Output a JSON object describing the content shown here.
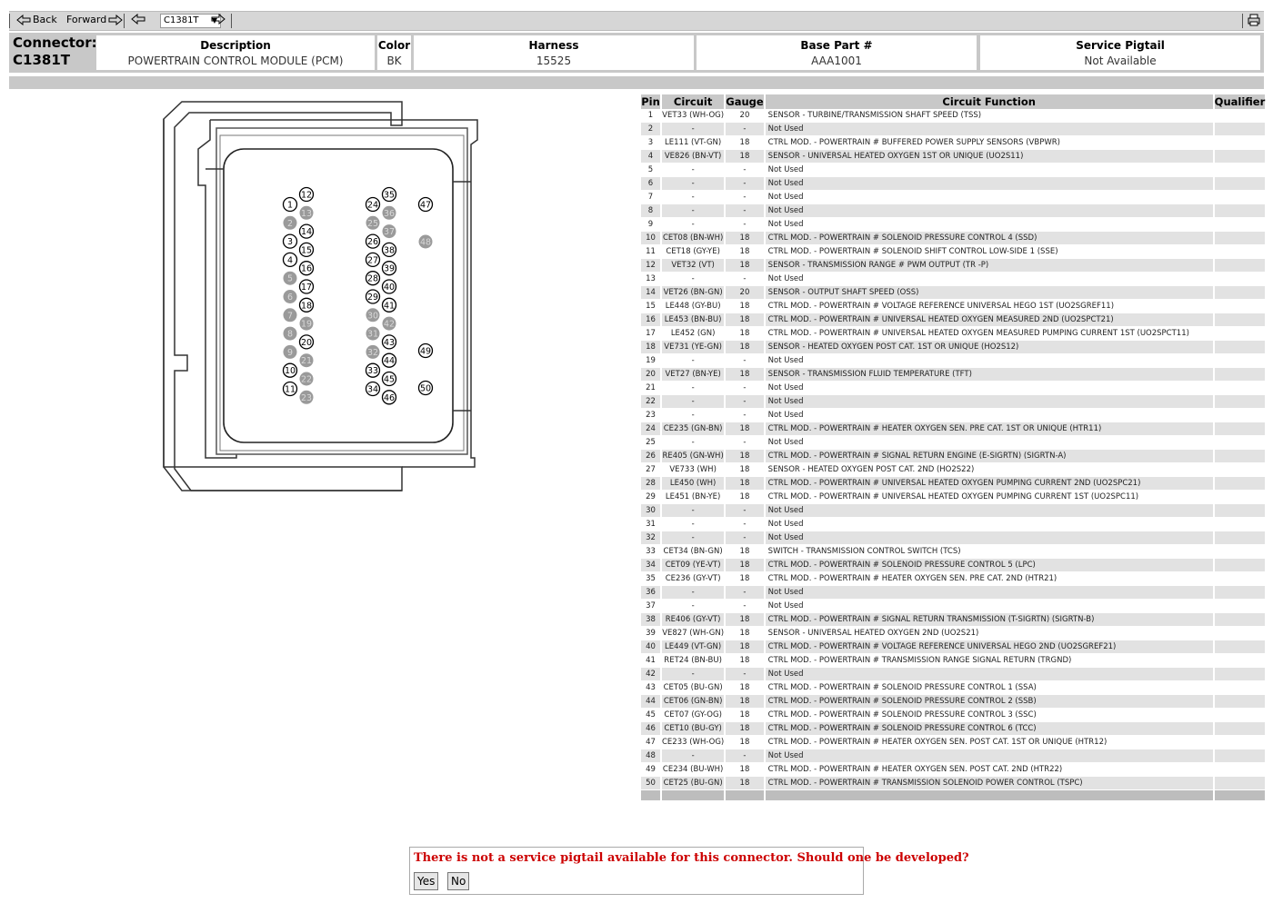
{
  "toolbar": {
    "back_label": "Back",
    "forward_label": "Forward",
    "connector_select": "C1381T"
  },
  "header": {
    "connector_label": "Connector:",
    "connector_id": "C1381T",
    "description_label": "Description",
    "description_value": "POWERTRAIN CONTROL MODULE (PCM)",
    "color_label": "Color",
    "color_value": "BK",
    "harness_label": "Harness",
    "harness_value": "15525",
    "base_part_label": "Base Part #",
    "base_part_value": "AAA1001",
    "pigtail_label": "Service Pigtail",
    "pigtail_value": "Not Available"
  },
  "table": {
    "headers": [
      "Pin",
      "Circuit",
      "Gauge",
      "Circuit Function",
      "Qualifier"
    ],
    "rows": [
      [
        "1",
        "VET33 (WH-OG)",
        "20",
        "SENSOR - TURBINE/TRANSMISSION SHAFT SPEED (TSS)",
        ""
      ],
      [
        "2",
        "-",
        "-",
        "Not Used",
        ""
      ],
      [
        "3",
        "LE111 (VT-GN)",
        "18",
        "CTRL MOD. - POWERTRAIN # BUFFERED POWER SUPPLY SENSORS (VBPWR)",
        ""
      ],
      [
        "4",
        "VE826 (BN-VT)",
        "18",
        "SENSOR - UNIVERSAL HEATED OXYGEN 1ST OR UNIQUE (UO2S11)",
        ""
      ],
      [
        "5",
        "-",
        "-",
        "Not Used",
        ""
      ],
      [
        "6",
        "-",
        "-",
        "Not Used",
        ""
      ],
      [
        "7",
        "-",
        "-",
        "Not Used",
        ""
      ],
      [
        "8",
        "-",
        "-",
        "Not Used",
        ""
      ],
      [
        "9",
        "-",
        "-",
        "Not Used",
        ""
      ],
      [
        "10",
        "CET08 (BN-WH)",
        "18",
        "CTRL MOD. - POWERTRAIN # SOLENOID PRESSURE CONTROL 4 (SSD)",
        ""
      ],
      [
        "11",
        "CET18 (GY-YE)",
        "18",
        "CTRL MOD. - POWERTRAIN # SOLENOID SHIFT CONTROL LOW-SIDE 1 (SSE)",
        ""
      ],
      [
        "12",
        "VET32 (VT)",
        "18",
        "SENSOR - TRANSMISSION RANGE # PWM OUTPUT (TR -P)",
        ""
      ],
      [
        "13",
        "-",
        "-",
        "Not Used",
        ""
      ],
      [
        "14",
        "VET26 (BN-GN)",
        "20",
        "SENSOR - OUTPUT SHAFT SPEED (OSS)",
        ""
      ],
      [
        "15",
        "LE448 (GY-BU)",
        "18",
        "CTRL MOD. - POWERTRAIN # VOLTAGE REFERENCE UNIVERSAL HEGO 1ST (UO2SGREF11)",
        ""
      ],
      [
        "16",
        "LE453 (BN-BU)",
        "18",
        "CTRL MOD. - POWERTRAIN # UNIVERSAL HEATED OXYGEN MEASURED 2ND (UO2SPCT21)",
        ""
      ],
      [
        "17",
        "LE452 (GN)",
        "18",
        "CTRL MOD. - POWERTRAIN # UNIVERSAL HEATED OXYGEN MEASURED PUMPING CURRENT 1ST (UO2SPCT11)",
        ""
      ],
      [
        "18",
        "VE731 (YE-GN)",
        "18",
        "SENSOR - HEATED OXYGEN POST CAT. 1ST OR UNIQUE (HO2S12)",
        ""
      ],
      [
        "19",
        "-",
        "-",
        "Not Used",
        ""
      ],
      [
        "20",
        "VET27 (BN-YE)",
        "18",
        "SENSOR - TRANSMISSION FLUID TEMPERATURE (TFT)",
        ""
      ],
      [
        "21",
        "-",
        "-",
        "Not Used",
        ""
      ],
      [
        "22",
        "-",
        "-",
        "Not Used",
        ""
      ],
      [
        "23",
        "-",
        "-",
        "Not Used",
        ""
      ],
      [
        "24",
        "CE235 (GN-BN)",
        "18",
        "CTRL MOD. - POWERTRAIN # HEATER OXYGEN SEN. PRE CAT. 1ST OR UNIQUE (HTR11)",
        ""
      ],
      [
        "25",
        "-",
        "-",
        "Not Used",
        ""
      ],
      [
        "26",
        "RE405 (GN-WH)",
        "18",
        "CTRL MOD. - POWERTRAIN # SIGNAL RETURN ENGINE (E-SIGRTN) (SIGRTN-A)",
        ""
      ],
      [
        "27",
        "VE733 (WH)",
        "18",
        "SENSOR - HEATED OXYGEN POST CAT. 2ND (HO2S22)",
        ""
      ],
      [
        "28",
        "LE450 (WH)",
        "18",
        "CTRL MOD. - POWERTRAIN # UNIVERSAL HEATED OXYGEN PUMPING CURRENT 2ND (UO2SPC21)",
        ""
      ],
      [
        "29",
        "LE451 (BN-YE)",
        "18",
        "CTRL MOD. - POWERTRAIN # UNIVERSAL HEATED OXYGEN PUMPING CURRENT 1ST (UO2SPC11)",
        ""
      ],
      [
        "30",
        "-",
        "-",
        "Not Used",
        ""
      ],
      [
        "31",
        "-",
        "-",
        "Not Used",
        ""
      ],
      [
        "32",
        "-",
        "-",
        "Not Used",
        ""
      ],
      [
        "33",
        "CET34 (BN-GN)",
        "18",
        "SWITCH - TRANSMISSION CONTROL SWITCH (TCS)",
        ""
      ],
      [
        "34",
        "CET09 (YE-VT)",
        "18",
        "CTRL MOD. - POWERTRAIN # SOLENOID PRESSURE CONTROL 5 (LPC)",
        ""
      ],
      [
        "35",
        "CE236 (GY-VT)",
        "18",
        "CTRL MOD. - POWERTRAIN # HEATER OXYGEN SEN. PRE CAT. 2ND (HTR21)",
        ""
      ],
      [
        "36",
        "-",
        "-",
        "Not Used",
        ""
      ],
      [
        "37",
        "-",
        "-",
        "Not Used",
        ""
      ],
      [
        "38",
        "RE406 (GY-VT)",
        "18",
        "CTRL MOD. - POWERTRAIN # SIGNAL RETURN TRANSMISSION (T-SIGRTN) (SIGRTN-B)",
        ""
      ],
      [
        "39",
        "VE827 (WH-GN)",
        "18",
        "SENSOR - UNIVERSAL HEATED OXYGEN 2ND (UO2S21)",
        ""
      ],
      [
        "40",
        "LE449 (VT-GN)",
        "18",
        "CTRL MOD. - POWERTRAIN # VOLTAGE REFERENCE UNIVERSAL HEGO 2ND (UO2SGREF21)",
        ""
      ],
      [
        "41",
        "RET24 (BN-BU)",
        "18",
        "CTRL MOD. - POWERTRAIN # TRANSMISSION RANGE SIGNAL RETURN (TRGND)",
        ""
      ],
      [
        "42",
        "-",
        "-",
        "Not Used",
        ""
      ],
      [
        "43",
        "CET05 (BU-GN)",
        "18",
        "CTRL MOD. - POWERTRAIN # SOLENOID PRESSURE CONTROL 1 (SSA)",
        ""
      ],
      [
        "44",
        "CET06 (GN-BN)",
        "18",
        "CTRL MOD. - POWERTRAIN # SOLENOID PRESSURE CONTROL 2 (SSB)",
        ""
      ],
      [
        "45",
        "CET07 (GY-OG)",
        "18",
        "CTRL MOD. - POWERTRAIN # SOLENOID PRESSURE CONTROL 3 (SSC)",
        ""
      ],
      [
        "46",
        "CET10 (BU-GY)",
        "18",
        "CTRL MOD. - POWERTRAIN # SOLENOID PRESSURE CONTROL 6 (TCC)",
        ""
      ],
      [
        "47",
        "CE233 (WH-OG)",
        "18",
        "CTRL MOD. - POWERTRAIN # HEATER OXYGEN SEN. POST CAT. 1ST OR UNIQUE (HTR12)",
        ""
      ],
      [
        "48",
        "-",
        "-",
        "Not Used",
        ""
      ],
      [
        "49",
        "CE234 (BU-WH)",
        "18",
        "CTRL MOD. - POWERTRAIN # HEATER OXYGEN SEN. POST CAT. 2ND (HTR22)",
        ""
      ],
      [
        "50",
        "CET25 (BU-GN)",
        "18",
        "CTRL MOD. - POWERTRAIN # TRANSMISSION SOLENOID POWER CONTROL (TSPC)",
        ""
      ]
    ]
  },
  "diagram": {
    "pins": [
      {
        "n": "1",
        "used": true
      },
      {
        "n": "2",
        "used": false
      },
      {
        "n": "3",
        "used": true
      },
      {
        "n": "4",
        "used": true
      },
      {
        "n": "5",
        "used": false
      },
      {
        "n": "6",
        "used": false
      },
      {
        "n": "7",
        "used": false
      },
      {
        "n": "8",
        "used": false
      },
      {
        "n": "9",
        "used": false
      },
      {
        "n": "10",
        "used": true
      },
      {
        "n": "11",
        "used": true
      },
      {
        "n": "12",
        "used": true
      },
      {
        "n": "13",
        "used": false
      },
      {
        "n": "14",
        "used": true
      },
      {
        "n": "15",
        "used": true
      },
      {
        "n": "16",
        "used": true
      },
      {
        "n": "17",
        "used": true
      },
      {
        "n": "18",
        "used": true
      },
      {
        "n": "19",
        "used": false
      },
      {
        "n": "20",
        "used": true
      },
      {
        "n": "21",
        "used": false
      },
      {
        "n": "22",
        "used": false
      },
      {
        "n": "23",
        "used": false
      },
      {
        "n": "24",
        "used": true
      },
      {
        "n": "25",
        "used": false
      },
      {
        "n": "26",
        "used": true
      },
      {
        "n": "27",
        "used": true
      },
      {
        "n": "28",
        "used": true
      },
      {
        "n": "29",
        "used": true
      },
      {
        "n": "30",
        "used": false
      },
      {
        "n": "31",
        "used": false
      },
      {
        "n": "32",
        "used": false
      },
      {
        "n": "33",
        "used": true
      },
      {
        "n": "34",
        "used": true
      },
      {
        "n": "35",
        "used": true
      },
      {
        "n": "36",
        "used": false
      },
      {
        "n": "37",
        "used": false
      },
      {
        "n": "38",
        "used": true
      },
      {
        "n": "39",
        "used": true
      },
      {
        "n": "40",
        "used": true
      },
      {
        "n": "41",
        "used": true
      },
      {
        "n": "42",
        "used": false
      },
      {
        "n": "43",
        "used": true
      },
      {
        "n": "44",
        "used": true
      },
      {
        "n": "45",
        "used": true
      },
      {
        "n": "46",
        "used": true
      },
      {
        "n": "47",
        "used": true
      },
      {
        "n": "48",
        "used": false
      },
      {
        "n": "49",
        "used": true
      },
      {
        "n": "50",
        "used": true
      }
    ]
  },
  "dialog": {
    "message": "There is not a service pigtail available for this connector. Should one be developed?",
    "yes_label": "Yes",
    "no_label": "No"
  },
  "colors": {
    "header_gray": "#c8c8c8",
    "row_alt": "#e2e2e2",
    "unused_pin": "#9a9a9a",
    "alert_red": "#cc0000"
  }
}
